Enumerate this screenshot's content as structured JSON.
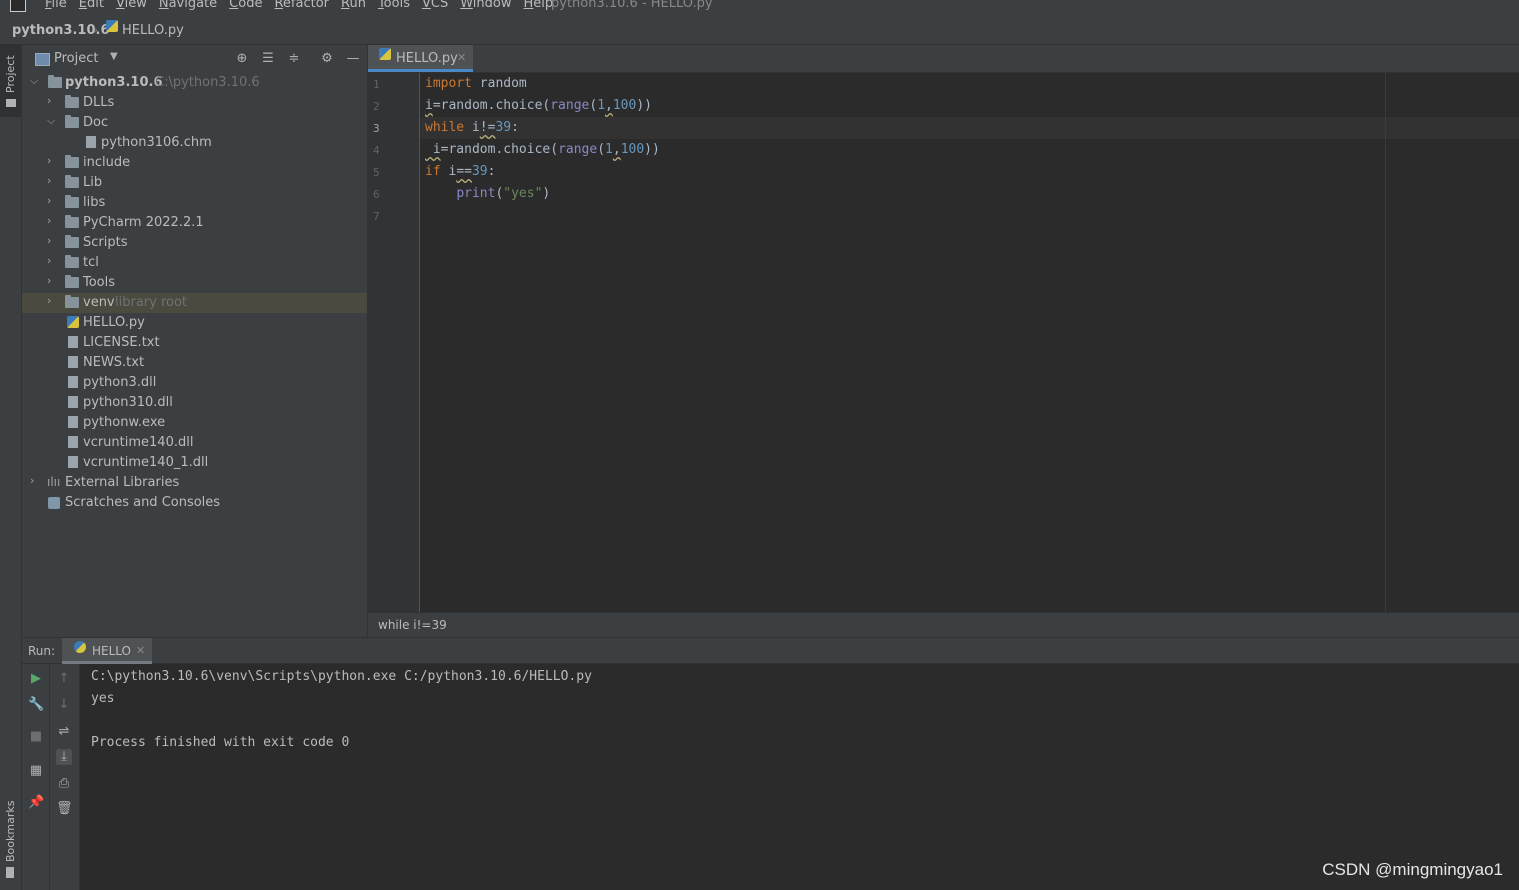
{
  "menubar": {
    "items": [
      "File",
      "Edit",
      "View",
      "Navigate",
      "Code",
      "Refactor",
      "Run",
      "Tools",
      "VCS",
      "Window",
      "Help"
    ],
    "window_title": "python3.10.6 - HELLO.py"
  },
  "breadcrumb": {
    "project": "python3.10.6",
    "file": "HELLO.py"
  },
  "sidebar": {
    "project_tab": "Project",
    "bookmarks_tab": "Bookmarks"
  },
  "project_panel": {
    "title": "Project",
    "root": {
      "name": "python3.10.6",
      "path": "C:\\python3.10.6"
    },
    "items": [
      {
        "label": "DLLs"
      },
      {
        "label": "Doc"
      },
      {
        "label": "python3106.chm"
      },
      {
        "label": "include"
      },
      {
        "label": "Lib"
      },
      {
        "label": "libs"
      },
      {
        "label": "PyCharm 2022.2.1"
      },
      {
        "label": "Scripts"
      },
      {
        "label": "tcl"
      },
      {
        "label": "Tools"
      },
      {
        "label": "venv",
        "hint": "library root"
      },
      {
        "label": "HELLO.py"
      },
      {
        "label": "LICENSE.txt"
      },
      {
        "label": "NEWS.txt"
      },
      {
        "label": "python3.dll"
      },
      {
        "label": "python310.dll"
      },
      {
        "label": "pythonw.exe"
      },
      {
        "label": "vcruntime140.dll"
      },
      {
        "label": "vcruntime140_1.dll"
      },
      {
        "label": "External Libraries"
      },
      {
        "label": "Scratches and Consoles"
      }
    ]
  },
  "editor": {
    "tab_label": "HELLO.py",
    "line_numbers": [
      "1",
      "2",
      "3",
      "4",
      "5",
      "6",
      "7"
    ],
    "code": {
      "l1_kw": "import",
      "l1_rest": " random",
      "l2_a": "i",
      "l2_b": "=random.choice(",
      "l2_fn": "range",
      "l2_c": "(",
      "l2_n1": "1",
      "l2_d": ",",
      "l2_n2": "100",
      "l2_e": "))",
      "l3_kw": "while",
      "l3_a": " i",
      "l3_op": "!=",
      "l3_num": "39",
      "l3_b": ":",
      "l4_a": " i",
      "l4_b": "=random.choice(",
      "l4_fn": "range",
      "l4_c": "(",
      "l4_n1": "1",
      "l4_d": ",",
      "l4_n2": "100",
      "l4_e": "))",
      "l5_kw": "if",
      "l5_a": " i",
      "l5_op": "==",
      "l5_num": "39",
      "l5_b": ":",
      "l6_ind": "    ",
      "l6_fn": "print",
      "l6_a": "(",
      "l6_str": "\"yes\"",
      "l6_b": ")"
    },
    "status_text": "while i!=39"
  },
  "run": {
    "label": "Run:",
    "tab_label": "HELLO",
    "output": [
      "C:\\python3.10.6\\venv\\Scripts\\python.exe C:/python3.10.6/HELLO.py",
      "yes",
      "",
      "Process finished with exit code 0"
    ]
  },
  "watermark": "CSDN @mingmingyao1"
}
